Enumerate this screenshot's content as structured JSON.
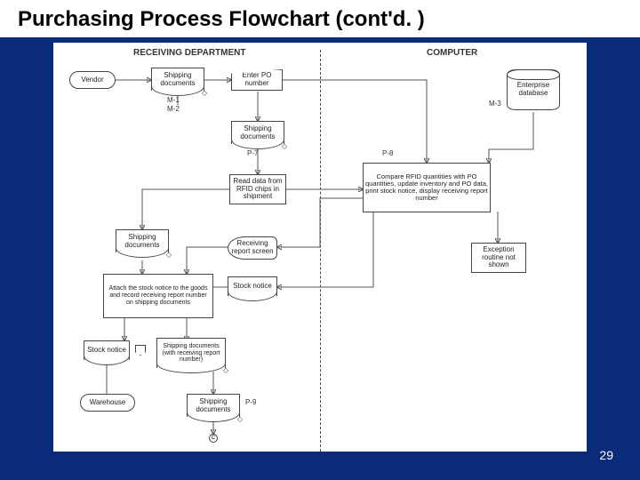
{
  "title": "Purchasing Process Flowchart (cont'd. )",
  "page_number": "29",
  "columns": {
    "left": "RECEIVING DEPARTMENT",
    "right": "COMPUTER"
  },
  "labels": {
    "m1": "M-1",
    "m2": "M-2",
    "m3": "M-3",
    "p7": "P-7",
    "p8": "P-8",
    "p9": "P-9"
  },
  "nodes": {
    "vendor": "Vendor",
    "ship_docs1": "Shipping documents",
    "enter_po": "Enter PO number",
    "ship_docs2": "Shipping documents",
    "read_rfid": "Read data from RFID chips in shipment",
    "ship_docs3": "Shipping documents",
    "recv_screen": "Receiving report screen",
    "attach": "Attach the stock notice to the goods and record receiving report number on shipping documents",
    "stock_notice1": "Stock notice",
    "stock_notice2": "Stock notice",
    "ship_docs4": "Shipping documents (with receiving report number)",
    "warehouse": "Warehouse",
    "ship_docs5": "Shipping documents",
    "compare": "Compare RFID quantities with PO quantities, update inventory and PO data, print stock notice, display receiving report number",
    "exception": "Exception routine not shown",
    "enterprise_db": "Enterprise database",
    "conn_c": "C"
  }
}
